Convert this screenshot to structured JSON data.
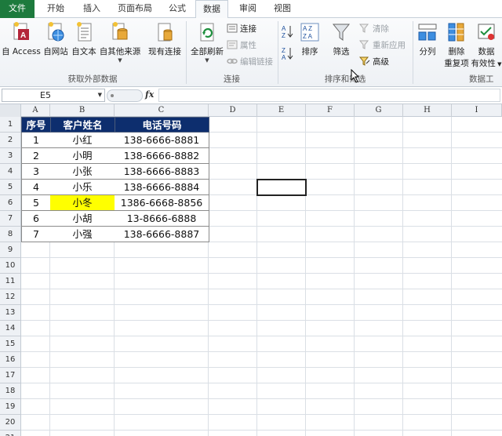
{
  "tabs": [
    "文件",
    "开始",
    "插入",
    "页面布局",
    "公式",
    "数据",
    "审阅",
    "视图"
  ],
  "ribbon": {
    "group1": {
      "buttons": [
        "自 Access",
        "自网站",
        "自文本",
        "自其他来源",
        "现有连接"
      ],
      "label": "获取外部数据"
    },
    "group2": {
      "refresh": "全部刷新",
      "items": [
        "连接",
        "属性",
        "编辑链接"
      ],
      "label": "连接"
    },
    "group3": {
      "sort": "排序",
      "filter": "筛选",
      "items": [
        "清除",
        "重新应用",
        "高级"
      ],
      "label": "排序和筛选"
    },
    "group4": {
      "buttons": [
        "分列",
        "删除",
        "重复项",
        "数据",
        "有效性"
      ],
      "label": "数据工"
    }
  },
  "formula_bar": {
    "name_box": "E5",
    "fx": "fx"
  },
  "columns": [
    "A",
    "B",
    "C",
    "D",
    "E",
    "F",
    "G",
    "H",
    "I"
  ],
  "rows": [
    "1",
    "2",
    "3",
    "4",
    "5",
    "6",
    "7",
    "8",
    "9",
    "10",
    "11",
    "12",
    "13",
    "14",
    "15",
    "16",
    "17",
    "18",
    "19",
    "20",
    "21"
  ],
  "table": {
    "headers": [
      "序号",
      "客户姓名",
      "电话号码"
    ],
    "rows": [
      [
        "1",
        "小红",
        "138-6666-8881"
      ],
      [
        "2",
        "小明",
        "138-6666-8882"
      ],
      [
        "3",
        "小张",
        "138-6666-8883"
      ],
      [
        "4",
        "小乐",
        "138-6666-8884"
      ],
      [
        "5",
        "小冬",
        "1386-6668-8856"
      ],
      [
        "6",
        "小胡",
        "13-8666-6888"
      ],
      [
        "7",
        "小强",
        "138-6666-8887"
      ]
    ]
  },
  "colors": {
    "header_fill": "#0d2e6e",
    "highlight": "#ffff00",
    "file_tab": "#1d7a3d"
  }
}
